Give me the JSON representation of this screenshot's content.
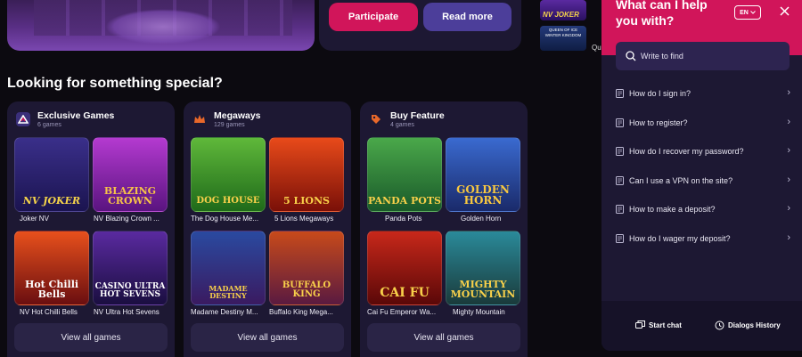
{
  "promo": {
    "participate_label": "Participate",
    "read_more_label": "Read more"
  },
  "mini_games": [
    {
      "title": "NV JOKER"
    },
    {
      "title": "QUEEN OF ICE WINTER KINGDOM",
      "label": "Qu"
    }
  ],
  "section_title": "Looking for something special?",
  "collections": [
    {
      "title": "Exclusive Games",
      "count": "6 games",
      "icon": "nv-logo-icon",
      "view_all_label": "View all games",
      "games": [
        {
          "name": "Joker NV",
          "art": "NV JOKER"
        },
        {
          "name": "NV Blazing Crown ...",
          "art": "BLAZING CROWN"
        },
        {
          "name": "NV Hot Chilli Bells",
          "art": "Hot Chilli Bells"
        },
        {
          "name": "NV Ultra Hot Sevens",
          "art": "CASINO ULTRA HOT SEVENS"
        }
      ]
    },
    {
      "title": "Megaways",
      "count": "129 games",
      "icon": "crown-icon",
      "view_all_label": "View all games",
      "games": [
        {
          "name": "The Dog House Me...",
          "art": "DOG HOUSE"
        },
        {
          "name": "5 Lions Megaways",
          "art": "5 LIONS"
        },
        {
          "name": "Madame Destiny M...",
          "art": "MADAME DESTINY"
        },
        {
          "name": "Buffalo King Mega...",
          "art": "BUFFALO KING"
        }
      ]
    },
    {
      "title": "Buy Feature",
      "count": "4 games",
      "icon": "price-tag-icon",
      "view_all_label": "View all games",
      "games": [
        {
          "name": "Panda Pots",
          "art": "PANDA POTS"
        },
        {
          "name": "Golden Horn",
          "art": "GOLDEN HORN"
        },
        {
          "name": "Cai Fu Emperor Wa...",
          "art": "CAI FU"
        },
        {
          "name": "Mighty Mountain",
          "art": "MIGHTY MOUNTAIN"
        }
      ]
    }
  ],
  "help": {
    "title": "What can I help you with?",
    "language": "EN",
    "search_placeholder": "Write to find",
    "faqs": [
      "How do I sign in?",
      "How to register?",
      "How do I recover my password?",
      "Can I use a VPN on the site?",
      "How to make a deposit?",
      "How do I wager my deposit?"
    ],
    "start_chat_label": "Start chat",
    "history_label": "Dialogs History"
  },
  "colors": {
    "accent": "#d1155a",
    "secondary": "#4c3e9a",
    "card": "#1d1833",
    "background": "#0c0a10"
  }
}
